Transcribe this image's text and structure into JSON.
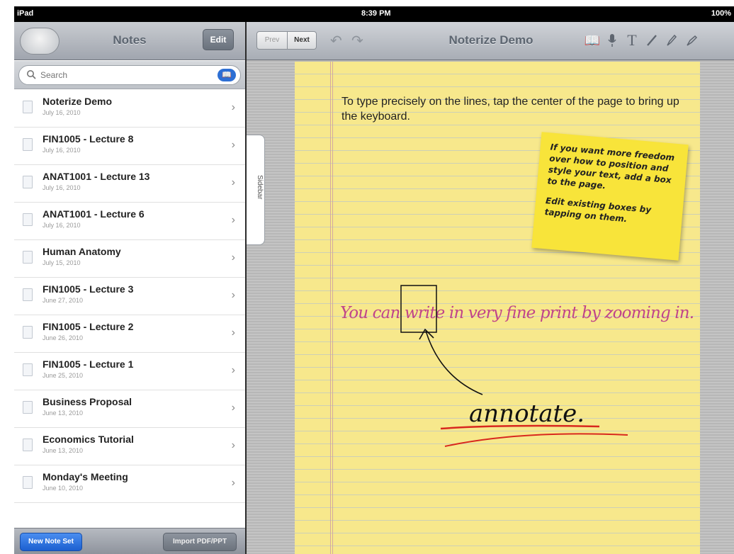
{
  "status": {
    "carrier": "iPad",
    "time": "8:39 PM",
    "battery": "100%"
  },
  "notes_panel": {
    "title": "Notes",
    "edit_label": "Edit",
    "search_placeholder": "Search",
    "items": [
      {
        "name": "Noterize Demo",
        "date": "July 16, 2010"
      },
      {
        "name": "FIN1005 - Lecture 8",
        "date": "July 16, 2010"
      },
      {
        "name": "ANAT1001 - Lecture 13",
        "date": "July 16, 2010"
      },
      {
        "name": "ANAT1001 - Lecture 6",
        "date": "July 16, 2010"
      },
      {
        "name": "Human Anatomy",
        "date": "July 15, 2010"
      },
      {
        "name": "FIN1005 - Lecture 3",
        "date": "June 27, 2010"
      },
      {
        "name": "FIN1005 - Lecture 2",
        "date": "June 26, 2010"
      },
      {
        "name": "FIN1005 - Lecture 1",
        "date": "June 25, 2010"
      },
      {
        "name": "Business Proposal",
        "date": "June 13, 2010"
      },
      {
        "name": "Economics Tutorial",
        "date": "June 13, 2010"
      },
      {
        "name": "Monday's Meeting",
        "date": "June 10, 2010"
      }
    ],
    "new_set_label": "New Note Set",
    "import_label": "Import PDF/PPT"
  },
  "sidebar_tab_label": "Sidebar",
  "editor": {
    "prev_label": "Prev",
    "next_label": "Next",
    "title": "Noterize Demo",
    "tools": [
      "book-icon",
      "microphone-icon",
      "text-tool-icon",
      "pen-icon",
      "highlighter-icon",
      "eraser-icon"
    ],
    "text_tool_glyph": "T",
    "typed_text": "To type precisely on the lines, tap the center of the page to bring up the keyboard.",
    "sticky_para1": "If you want more freedom over how to position and style your text, add a box to the page.",
    "sticky_para2": "Edit existing boxes by tapping on them.",
    "handwriting_line": "You can write in very fine print by zooming in.",
    "handwriting_annotate": "annotate.",
    "ink_colors": {
      "pink": "#c0458a",
      "black": "#111111",
      "red": "#d8281e"
    }
  }
}
